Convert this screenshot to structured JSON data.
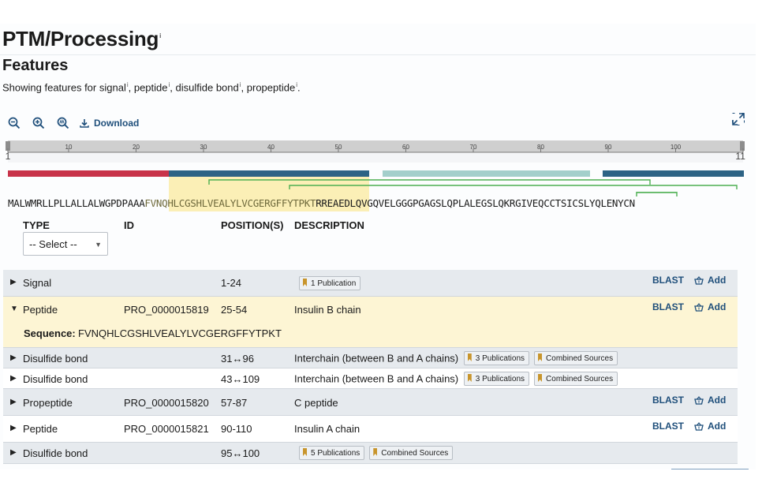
{
  "page": {
    "title": "PTM/Processing",
    "title_info": "i"
  },
  "features": {
    "title": "Features",
    "summary_prefix": "Showing features for",
    "summary_types": [
      "signal",
      "peptide",
      "disulfide bond",
      "propeptide"
    ],
    "info_mark": "i"
  },
  "toolbar": {
    "download_label": "Download"
  },
  "ruler": {
    "ticks": [
      "1",
      "10",
      "20",
      "30",
      "40",
      "50",
      "60",
      "70",
      "80",
      "90",
      "100",
      "110"
    ]
  },
  "tracks": {
    "colors": {
      "signal": "#c8334a",
      "peptide": "#2d6385",
      "propeptide": "#a3cfcb",
      "bond": "#4caf50",
      "highlight": "#fbefb6"
    },
    "sequence_start": "MALWMRLLPLLALLALWGPDPAAA",
    "sequence_highlight": "FVNQHLCGSHLVEALYLVCGERGFFYTPKT",
    "sequence_end": "RREAEDLQVGQVELGGGPGAGSLQPLALEGSLQKRGIVEQCCTSICSLYQLENYCN"
  },
  "table": {
    "headers": {
      "type": "TYPE",
      "id": "ID",
      "position": "POSITION(S)",
      "description": "DESCRIPTION"
    },
    "type_filter": "-- Select --",
    "blast_label": "BLAST",
    "add_label": "Add",
    "sequence_label": "Sequence:",
    "rows": [
      {
        "type": "Signal",
        "id": "",
        "position": "1-24",
        "description": "",
        "badges": [
          "1 Publication"
        ]
      },
      {
        "type": "Peptide",
        "id": "PRO_0000015819",
        "position": "25-54",
        "description": "Insulin B chain",
        "badges": [],
        "sequence": "FVNQHLCGSHLVEALYLVCGERGFFYTPKT"
      },
      {
        "type": "Disulfide bond",
        "id": "",
        "position": "31↔96",
        "description": "Interchain (between B and A chains)",
        "badges": [
          "3 Publications",
          "Combined Sources"
        ]
      },
      {
        "type": "Disulfide bond",
        "id": "",
        "position": "43↔109",
        "description": "Interchain (between B and A chains)",
        "badges": [
          "3 Publications",
          "Combined Sources"
        ]
      },
      {
        "type": "Propeptide",
        "id": "PRO_0000015820",
        "position": "57-87",
        "description": "C peptide",
        "badges": []
      },
      {
        "type": "Peptide",
        "id": "PRO_0000015821",
        "position": "90-110",
        "description": "Insulin A chain",
        "badges": []
      },
      {
        "type": "Disulfide bond",
        "id": "",
        "position": "95↔100",
        "description": "",
        "badges": [
          "5 Publications",
          "Combined Sources"
        ]
      }
    ]
  }
}
